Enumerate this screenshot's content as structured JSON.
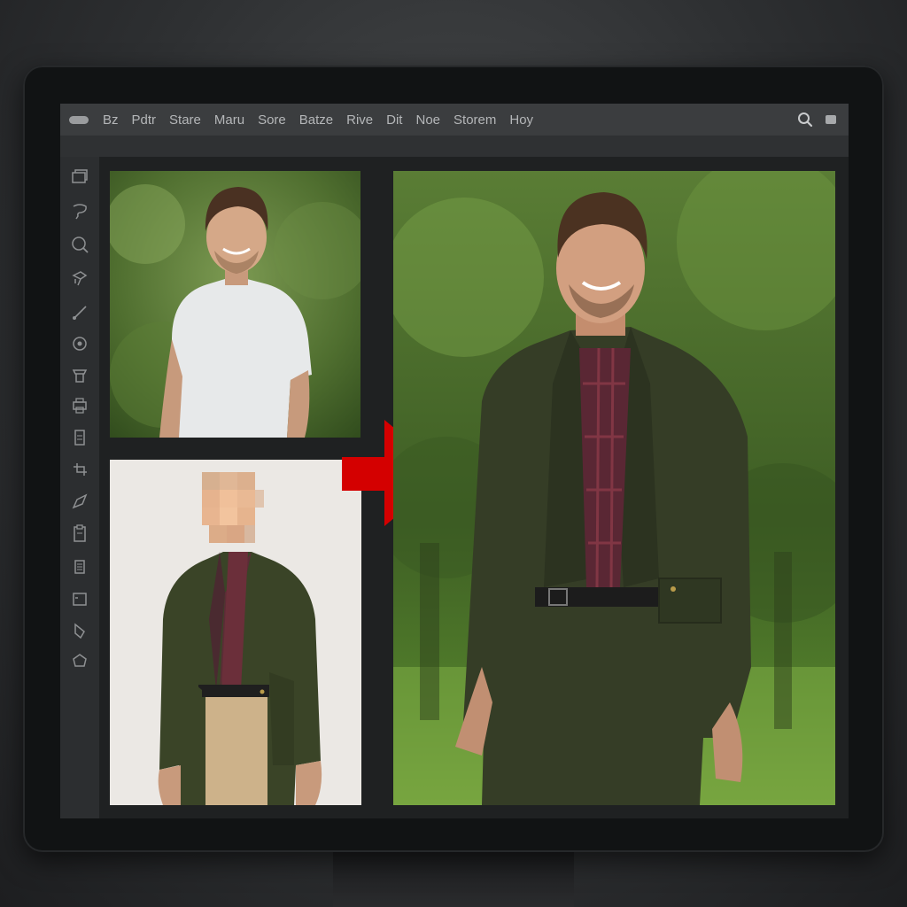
{
  "menu": {
    "items": [
      "Bz",
      "Pdtr",
      "Stare",
      "Maru",
      "Sore",
      "Batze",
      "Rive",
      "Dit",
      "Noe",
      "Storem",
      "Hoy"
    ]
  },
  "toolbar": {
    "tools": [
      "layers-icon",
      "lasso-icon",
      "zoom-icon",
      "stamp-icon",
      "brush-icon",
      "target-icon",
      "paint-bucket-icon",
      "printer-icon",
      "document-icon",
      "crop-icon",
      "pen-icon",
      "clipboard-icon",
      "list-icon",
      "frame-icon",
      "eraser-icon",
      "shape-icon"
    ]
  },
  "canvas": {
    "source_photo": "person-white-tshirt-park",
    "garment_photo": "olive-jacket-plaid-shirt-pixelated-face",
    "result_photo": "person-olive-jacket-park",
    "arrow_color": "#d40000"
  }
}
